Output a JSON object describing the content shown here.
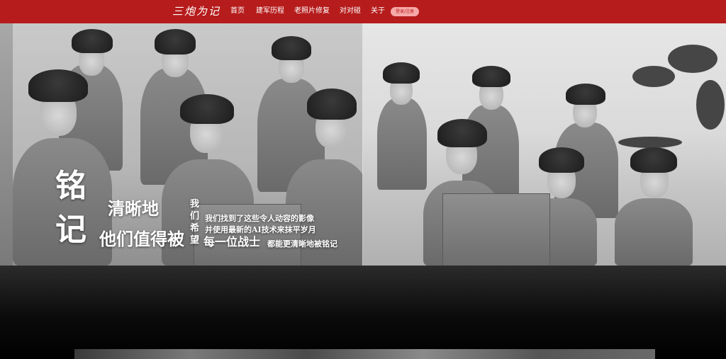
{
  "nav": {
    "logo": "三炮为记",
    "items": [
      "首页",
      "建军历程",
      "老照片修复",
      "对对碰",
      "关于"
    ],
    "login_button": "登录/注册"
  },
  "hero": {
    "title_chars": [
      "铭",
      "记"
    ],
    "line1": "清晰地",
    "line2": "他们值得被",
    "vertical_text": "我们希望",
    "desc1": "我们找到了这些令人动容的影像",
    "desc2": "并使用最新的AI技术来抹平岁月",
    "line3": "每一位战士",
    "line3_suffix": "都能更清晰地被铭记"
  },
  "colors": {
    "nav_bg": "#b61c1c",
    "button_bg": "#f7a8a8",
    "text": "#ffffff"
  }
}
